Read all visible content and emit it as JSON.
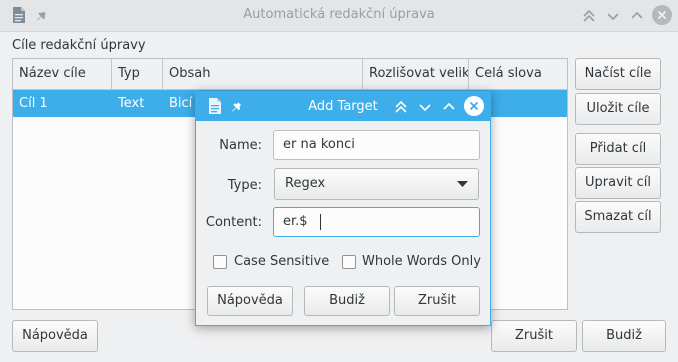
{
  "window": {
    "title": "Automatická redakční úprava",
    "app_icon": "document-icon",
    "pin_icon": "pin-icon"
  },
  "section_label": "Cíle redakční úpravy",
  "table": {
    "columns": [
      "Název cíle",
      "Typ",
      "Obsah",
      "Rozlišovat veliko",
      "Celá slova"
    ],
    "rows": [
      {
        "name": "Cíl 1",
        "type": "Text",
        "content": "Bicí",
        "case": "",
        "whole": ""
      }
    ]
  },
  "side_buttons": {
    "load": "Načíst cíle",
    "save": "Uložit cíle",
    "add": "Přidat cíl",
    "edit": "Upravit cíl",
    "delete": "Smazat cíl"
  },
  "bottom": {
    "help": "Nápověda",
    "cancel": "Zrušit",
    "ok": "Budiž"
  },
  "dialog": {
    "title": "Add Target",
    "name_label": "Name:",
    "name_value": "er na konci",
    "type_label": "Type:",
    "type_value": "Regex",
    "content_label": "Content:",
    "content_value": "er.$",
    "case_sensitive": "Case Sensitive",
    "whole_words": "Whole Words Only",
    "help": "Nápověda",
    "ok": "Budiž",
    "cancel": "Zrušit"
  },
  "colors": {
    "accent": "#3daee9",
    "window_bg": "#eff0f1"
  }
}
